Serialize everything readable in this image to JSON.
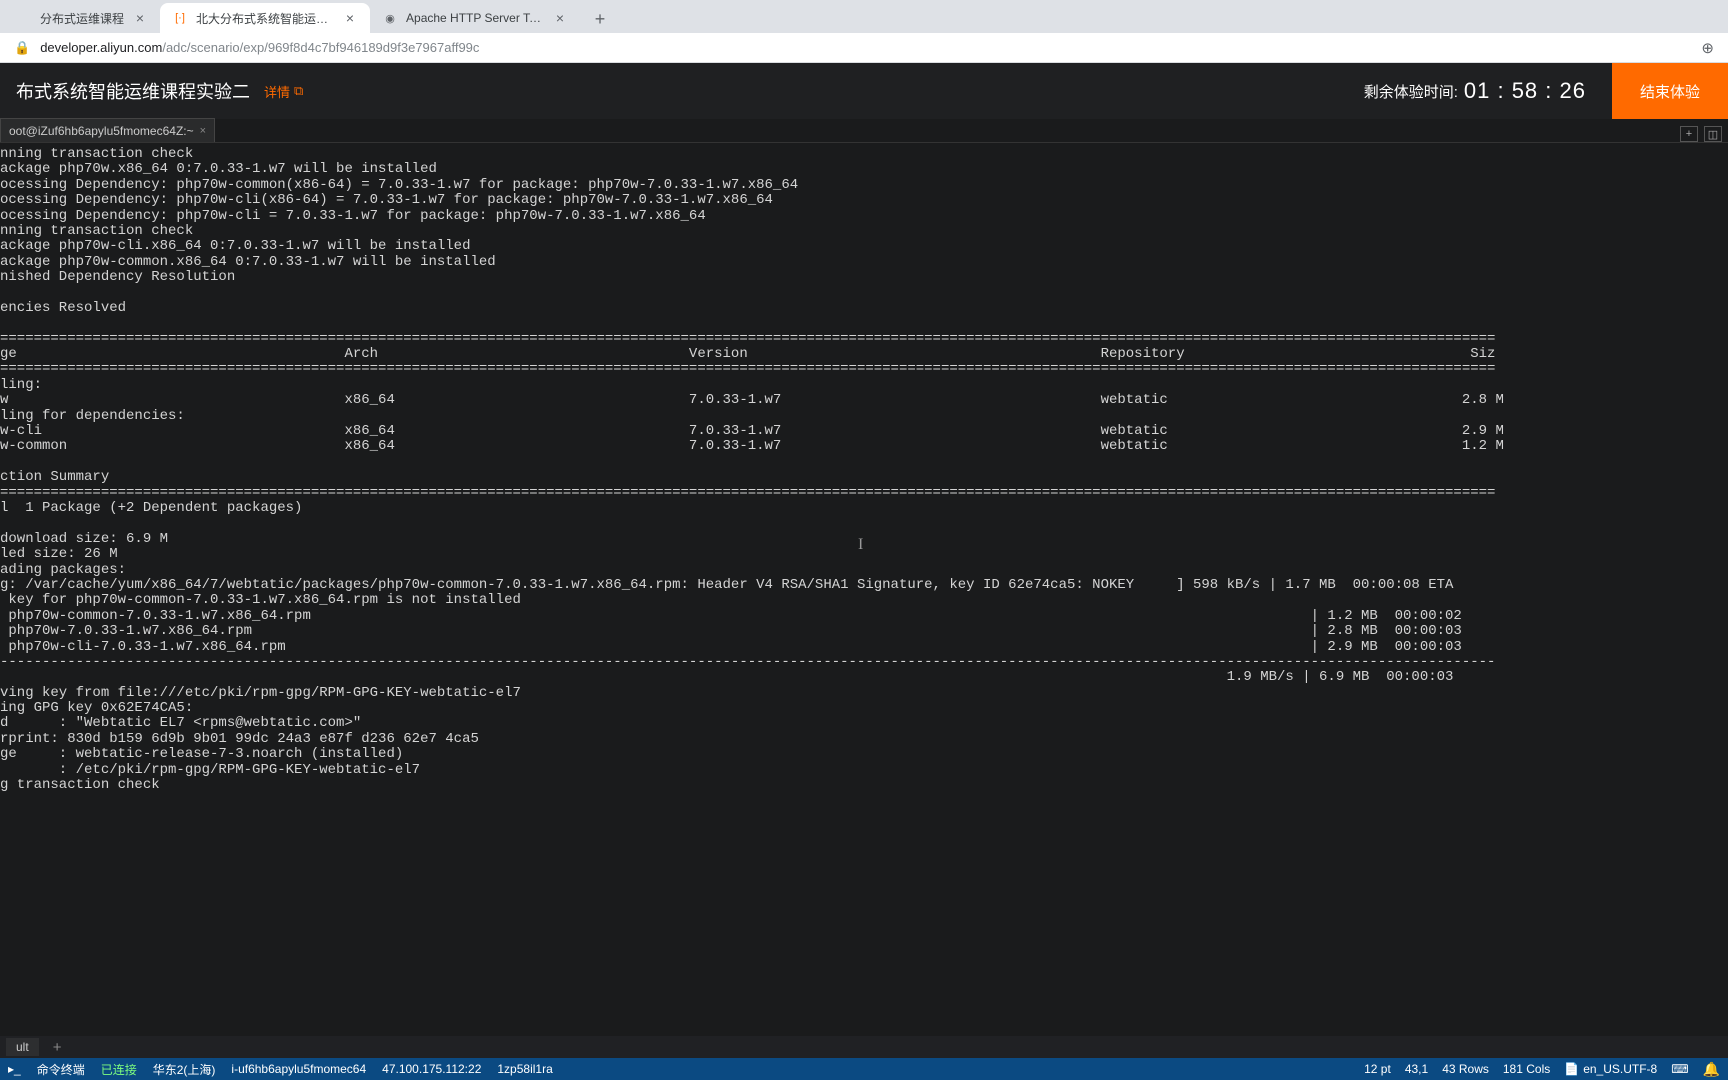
{
  "browser": {
    "tabs": [
      {
        "title": "分布式运维课程",
        "favicon": "",
        "active": false
      },
      {
        "title": "北大分布式系统智能运维课程实",
        "favicon": "[·]",
        "favclass": "fav-orange",
        "active": true
      },
      {
        "title": "Apache HTTP Server Test Pag…",
        "favicon": "◉",
        "favclass": "fav-grey",
        "active": false
      }
    ],
    "url_host": "developer.aliyun.com",
    "url_path": "/adc/scenario/exp/969f8d4c7bf946189d9f3e7967aff99c"
  },
  "header": {
    "title": "布式系统智能运维课程实验二",
    "detail_label": "详情",
    "countdown_label": "剩余体验时间:",
    "countdown_value": "01 : 58 : 26",
    "end_button": "结束体验"
  },
  "term_tab": {
    "label": "oot@iZuf6hb6apylu5fmomec64Z:~"
  },
  "terminal_text": "nning transaction check\nackage php70w.x86_64 0:7.0.33-1.w7 will be installed\nocessing Dependency: php70w-common(x86-64) = 7.0.33-1.w7 for package: php70w-7.0.33-1.w7.x86_64\nocessing Dependency: php70w-cli(x86-64) = 7.0.33-1.w7 for package: php70w-7.0.33-1.w7.x86_64\nocessing Dependency: php70w-cli = 7.0.33-1.w7 for package: php70w-7.0.33-1.w7.x86_64\nnning transaction check\nackage php70w-cli.x86_64 0:7.0.33-1.w7 will be installed\nackage php70w-common.x86_64 0:7.0.33-1.w7 will be installed\nnished Dependency Resolution\n\nencies Resolved\n\n==================================================================================================================================================================================\nge                                       Arch                                     Version                                          Repository                                  Siz\n==================================================================================================================================================================================\nling:\nw                                        x86_64                                   7.0.33-1.w7                                      webtatic                                   2.8 M\nling for dependencies:\nw-cli                                    x86_64                                   7.0.33-1.w7                                      webtatic                                   2.9 M\nw-common                                 x86_64                                   7.0.33-1.w7                                      webtatic                                   1.2 M\n\nction Summary\n==================================================================================================================================================================================\nl  1 Package (+2 Dependent packages)\n\ndownload size: 6.9 M\nled size: 26 M\nading packages:\ng: /var/cache/yum/x86_64/7/webtatic/packages/php70w-common-7.0.33-1.w7.x86_64.rpm: Header V4 RSA/SHA1 Signature, key ID 62e74ca5: NOKEY     ] 598 kB/s | 1.7 MB  00:00:08 ETA\n key for php70w-common-7.0.33-1.w7.x86_64.rpm is not installed\n php70w-common-7.0.33-1.w7.x86_64.rpm                                                                                                                       | 1.2 MB  00:00:02\n php70w-7.0.33-1.w7.x86_64.rpm                                                                                                                              | 2.8 MB  00:00:03\n php70w-cli-7.0.33-1.w7.x86_64.rpm                                                                                                                          | 2.9 MB  00:00:03\n----------------------------------------------------------------------------------------------------------------------------------------------------------------------------------\n                                                                                                                                                  1.9 MB/s | 6.9 MB  00:00:03\nving key from file:///etc/pki/rpm-gpg/RPM-GPG-KEY-webtatic-el7\ning GPG key 0x62E74CA5:\nd      : \"Webtatic EL7 <rpms@webtatic.com>\"\nrprint: 830d b159 6d9b 9b01 99dc 24a3 e87f d236 62e7 4ca5\nge     : webtatic-release-7-3.noarch (installed)\n       : /etc/pki/rpm-gpg/RPM-GPG-KEY-webtatic-el7\ng transaction check",
  "session": {
    "tab": "ult"
  },
  "status": {
    "terminal_label": "命令终端",
    "connected": "已连接",
    "region": "华东2(上海)",
    "instance": "i-uf6hb6apylu5fmomec64",
    "ip": "47.100.175.112:22",
    "session_id": "1zp58il1ra",
    "font": "12 pt",
    "cursor": "43,1",
    "rows": "43 Rows",
    "cols": "181 Cols",
    "encoding": "en_US.UTF-8"
  }
}
